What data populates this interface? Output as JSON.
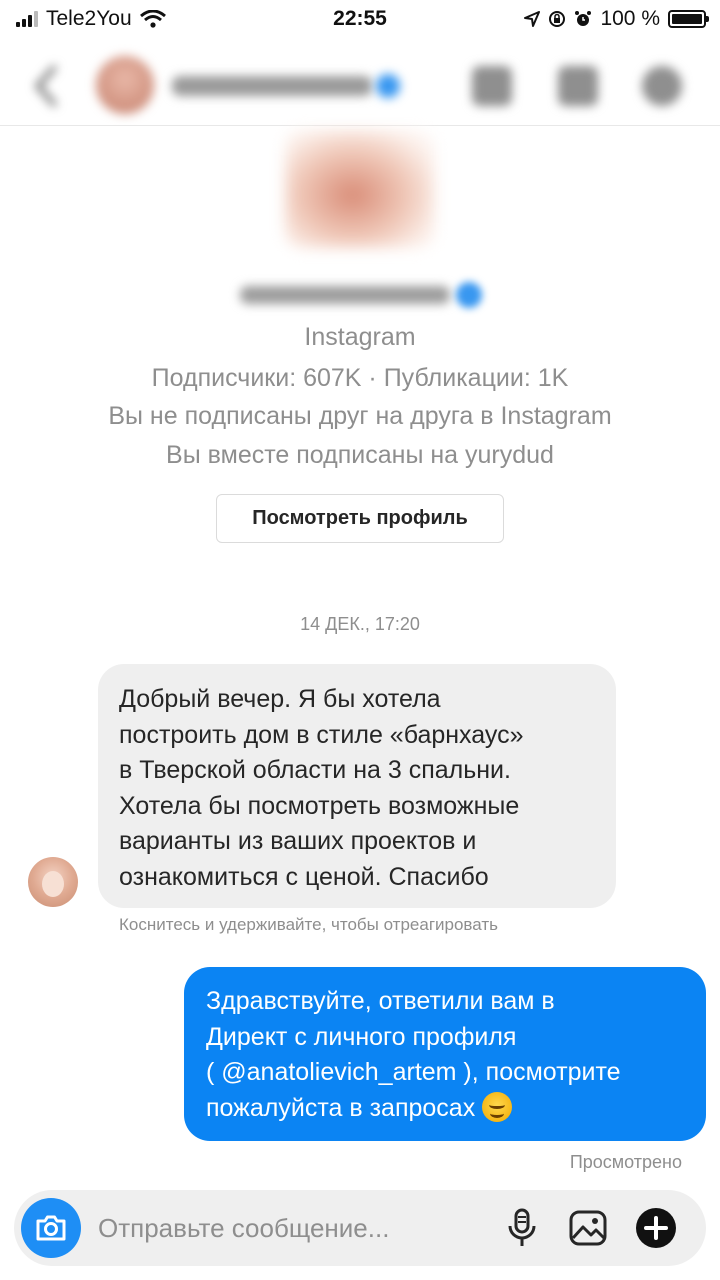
{
  "status_bar": {
    "carrier": "Tele2You",
    "time": "22:55",
    "battery_text": "100 %"
  },
  "header": {
    "back_icon": "chevron-left-icon",
    "video_icon": "video-camera-icon",
    "flag_icon": "flag-icon",
    "info_icon": "info-icon"
  },
  "profile": {
    "platform": "Instagram",
    "stats": "Подписчики: 607K · Публикации: 1K",
    "follow_status": "Вы не подписаны друг на друга в Instagram",
    "mutual": "Вы вместе подписаны на yurydud",
    "view_profile_label": "Посмотреть профиль"
  },
  "thread": {
    "date_stamp": "14 ДЕК., 17:20",
    "incoming_text": "Добрый вечер. Я бы хотела\nпостроить дом в стиле «барнхаус»\nв Тверской области на 3 спальни.\nХотела бы посмотреть возможные\nварианты из ваших проектов и\nознакомиться с ценой. Спасибо",
    "react_hint": "Коснитесь и удерживайте, чтобы отреагировать",
    "outgoing_text": "Здравствуйте, ответили вам в\nДирект с личного профиля\n( @anatolievich_artem ), посмотрите\nпожалуйста в запросах ",
    "outgoing_emoji": "smiling-face-emoji",
    "seen_label": "Просмотрено"
  },
  "composer": {
    "placeholder": "Отправьте сообщение...",
    "camera_icon": "camera-icon",
    "mic_icon": "microphone-icon",
    "gallery_icon": "image-icon",
    "plus_icon": "plus-icon"
  },
  "colors": {
    "accent_blue": "#0b84f3",
    "incoming_bubble": "#efefef",
    "secondary_text": "#8e8e8e"
  }
}
